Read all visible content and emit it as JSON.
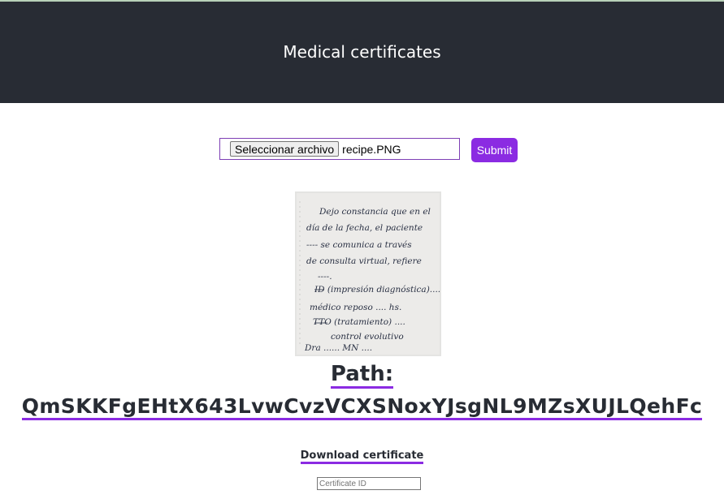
{
  "header": {
    "title": "Medical certificates",
    "background": "#282c34"
  },
  "upload": {
    "choose_button_label": "Seleccionar archivo",
    "selected_file": "recipe.PNG",
    "submit_label": "Submit",
    "accent": "#8b2be2"
  },
  "preview": {
    "handwritten_lines": [
      "Dejo constancia que en el",
      "día de la fecha, el paciente",
      "---- se comunica a través",
      "de consulta virtual, refiere",
      "----.",
      "ID (impresión diagnóstica)....",
      "médico reposo .... hs.",
      "TTO (tratamiento) ....",
      "control evolutivo",
      "Dra ...... MN ...."
    ]
  },
  "result": {
    "path_label": "Path:",
    "path_value": "QmSKKFgEHtX643LvwCvzVCXSNoxYJsgNL9MZsXUJLQehFc",
    "download_label": "Download certificate",
    "certificate_placeholder": "Certificate ID"
  }
}
